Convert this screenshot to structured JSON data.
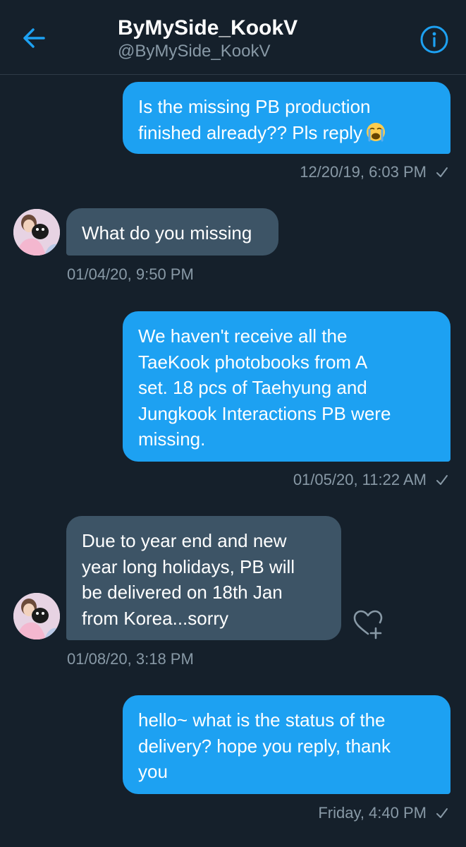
{
  "header": {
    "title": "ByMySide_KookV",
    "handle": "@ByMySide_KookV",
    "back_icon": "arrow-left-icon",
    "info_icon": "info-circle-icon",
    "accent_color": "#1da1f2"
  },
  "messages": [
    {
      "direction": "outgoing",
      "lines": [
        "Is the missing PB production",
        "finished already?? Pls reply"
      ],
      "emoji": "crying-face-emoji",
      "timestamp": "12/20/19, 6:03 PM",
      "status": "sent"
    },
    {
      "direction": "incoming",
      "lines": [
        "What do you missing"
      ],
      "timestamp": "01/04/20, 9:50 PM"
    },
    {
      "direction": "outgoing",
      "lines": [
        "We haven't receive all the",
        "TaeKook photobooks from A",
        "set. 18 pcs of Taehyung and",
        "Jungkook Interactions PB were",
        "missing."
      ],
      "timestamp": "01/05/20, 11:22 AM",
      "status": "sent"
    },
    {
      "direction": "incoming",
      "lines": [
        "Due to year end and new",
        "year long holidays,  PB will",
        "be delivered on 18th Jan",
        "from Korea...sorry"
      ],
      "timestamp": "01/08/20, 3:18 PM",
      "reaction_icon": "heart-plus-icon"
    },
    {
      "direction": "outgoing",
      "lines": [
        "hello~ what is the status of the",
        "delivery? hope you reply, thank",
        "you"
      ],
      "timestamp": "Friday, 4:40 PM",
      "status": "sent"
    }
  ],
  "colors": {
    "background": "#15202b",
    "outgoing_bubble": "#1da1f2",
    "incoming_bubble": "#3d5466",
    "secondary_text": "#8899a6"
  }
}
